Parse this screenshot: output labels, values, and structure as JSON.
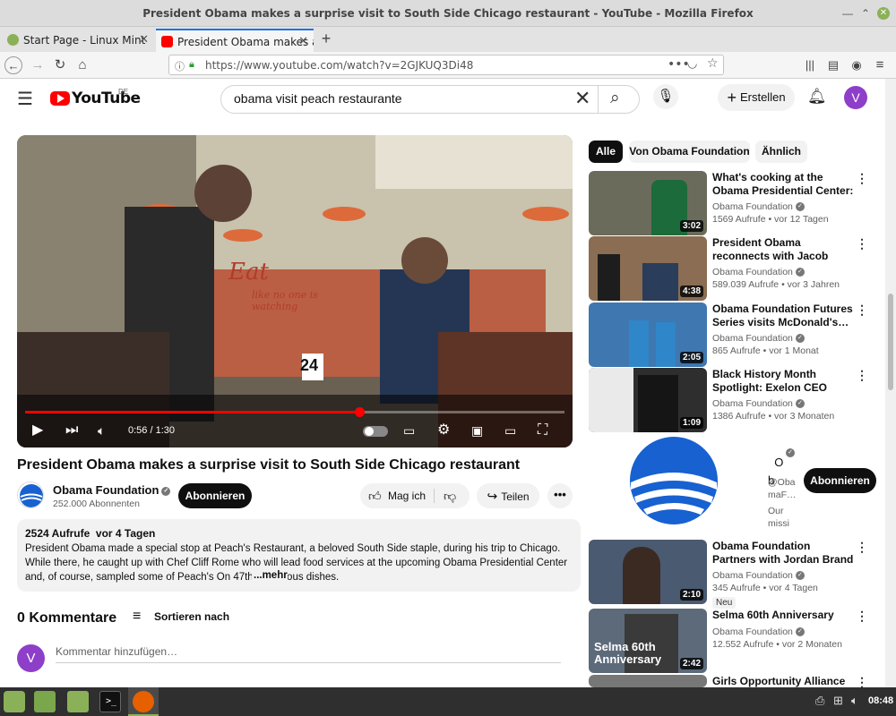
{
  "window": {
    "title": "President Obama makes a surprise visit to South Side Chicago restaurant - YouTube - Mozilla Firefox"
  },
  "tabs": [
    {
      "label": "Start Page - Linux Mint",
      "active": false
    },
    {
      "label": "President Obama makes a s",
      "active": true
    }
  ],
  "browser": {
    "url": "https://www.youtube.com/watch?v=2GJKUQ3Di48"
  },
  "yt": {
    "logo_text": "YouTube",
    "region": "DE",
    "search_value": "obama visit peach restaurante",
    "create_label": "Erstellen",
    "avatar_letter": "V"
  },
  "player": {
    "time": "0:56 / 1:30",
    "progress": 0.62,
    "sign_text": "Eat",
    "sign_sub": "like no one is watching",
    "table_number": "24"
  },
  "video": {
    "title": "President Obama makes a surprise visit to South Side Chicago restaurant",
    "channel": "Obama Foundation",
    "subscribers": "252.000 Abonnenten",
    "subscribe_label": "Abonnieren",
    "like_label": "Mag ich",
    "share_label": "Teilen"
  },
  "description": {
    "meta": "2524 Aufrufe  vor 4 Tagen",
    "text": "President Obama made a special stop at Peach's Restaurant, a beloved South Side staple, during his trip to Chicago. While there, he caught up with Chef Cliff Rome who will lead food services at the upcoming Obama Presidential Center and, of course, sampled some of Peach's On 47th's delicious dishes.",
    "more_label": "...mehr"
  },
  "comments": {
    "heading": "0 Kommentare",
    "sort_label": "Sortieren nach",
    "placeholder": "Kommentar hinzufügen…",
    "avatar_letter": "V"
  },
  "chips": [
    "Alle",
    "Von Obama Foundation",
    "Ähnlich"
  ],
  "recommendations": [
    {
      "title": "What's cooking at the Obama Presidential Center: Meet Chef…",
      "channel": "Obama Foundation",
      "meta": "1569 Aufrufe • vor 12 Tagen",
      "duration": "3:02",
      "thumb": "#6b6b5c"
    },
    {
      "title": "President Obama reconnects with Jacob Philadelphia",
      "channel": "Obama Foundation",
      "meta": "589.039 Aufrufe • vor 3 Jahren",
      "duration": "4:38",
      "thumb": "#8a6d52"
    },
    {
      "title": "Obama Foundation Futures Series visits McDonald's…",
      "channel": "Obama Foundation",
      "meta": "865 Aufrufe • vor 1 Monat",
      "duration": "2:05",
      "thumb": "#3f77b0"
    },
    {
      "title": "Black History Month Spotlight: Exelon CEO Calvin Butler",
      "channel": "Obama Foundation",
      "meta": "1386 Aufrufe • vor 3 Monaten",
      "duration": "1:09",
      "thumb": "#2e2e2e"
    }
  ],
  "channel_card": {
    "name_partial": "O\nb",
    "handle_partial": "@Oba\nmaF…",
    "desc_partial": "Our\nmissi",
    "subscribe_label": "Abonnieren"
  },
  "recommendations2": [
    {
      "title": "Obama Foundation Partners with Jordan Brand for Futures…",
      "channel": "Obama Foundation",
      "meta": "345 Aufrufe • vor 4 Tagen",
      "duration": "2:10",
      "badge": "Neu",
      "thumb": "#4a5a70"
    },
    {
      "title": "Selma 60th Anniversary",
      "channel": "Obama Foundation",
      "meta": "12.552 Aufrufe • vor 2 Monaten",
      "duration": "2:42",
      "thumb_text": "Selma 60th Anniversary",
      "thumb": "#5d6a7a"
    },
    {
      "title": "Girls Opportunity Alliance in…",
      "thumb": "#777"
    }
  ],
  "taskbar": {
    "clock": "08:48"
  },
  "colors": {
    "yt_red": "#ff0000",
    "progress_red": "#f00",
    "foundation_blue": "#1761d1",
    "mint_green": "#8bb158"
  }
}
